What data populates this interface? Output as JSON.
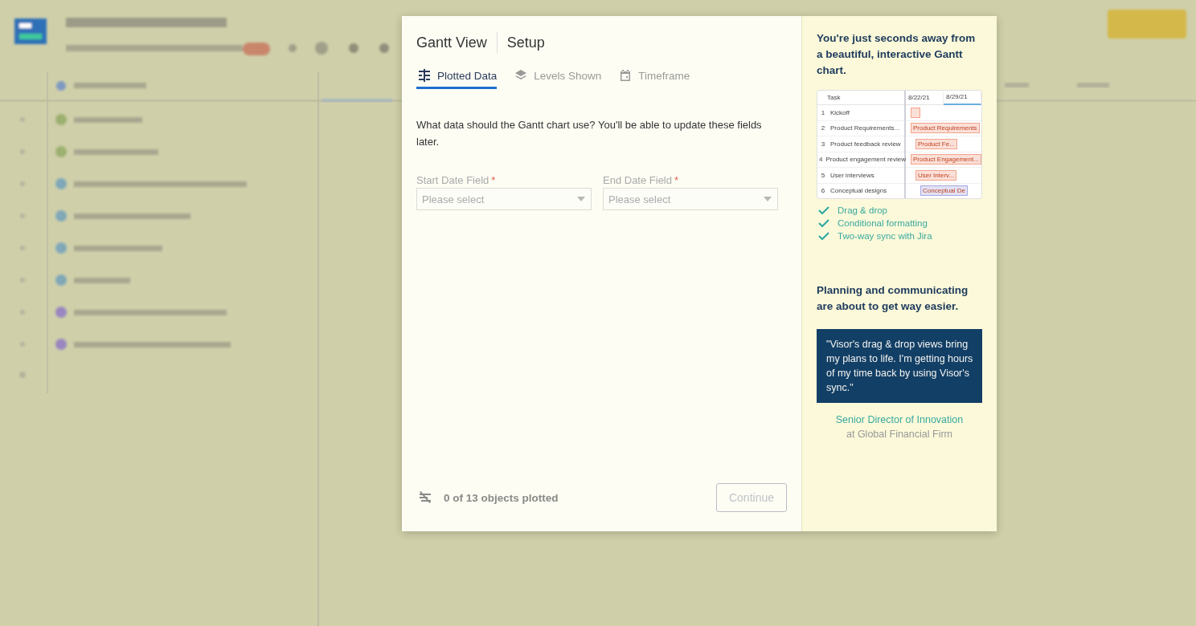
{
  "modal": {
    "title": "Gantt View",
    "subtitle": "Setup",
    "tabs": [
      {
        "label": "Plotted Data",
        "selected": true
      },
      {
        "label": "Levels Shown",
        "selected": false
      },
      {
        "label": "Timeframe",
        "selected": false
      }
    ],
    "intro": "What data should the Gantt chart use? You'll be able to update these fields later.",
    "fields": [
      {
        "label": "Start Date Field",
        "required_mark": "*",
        "placeholder": "Please select"
      },
      {
        "label": "End Date Field",
        "required_mark": "*",
        "placeholder": "Please select"
      }
    ],
    "status": "0 of 13 objects plotted",
    "continue": {
      "label": "Continue",
      "disabled": true
    }
  },
  "promo": {
    "headline": "You're just seconds away from a beautiful, interactive Gantt chart.",
    "preview": {
      "task_header": "Task",
      "dates": [
        "8/22/21",
        "8/29/21"
      ],
      "rows": [
        {
          "num": "1",
          "task": "Kickoff",
          "bar": "",
          "color": "#f4a38a"
        },
        {
          "num": "2",
          "task": "Product Requirements...",
          "bar": "Product Requirements",
          "color": "#f4a38a"
        },
        {
          "num": "3",
          "task": "Product feedback review",
          "bar": "Product Fe...",
          "color": "#f4a38a"
        },
        {
          "num": "4",
          "task": "Product engagement review",
          "bar": "Product Engagement...",
          "color": "#f4a38a"
        },
        {
          "num": "5",
          "task": "User interviews",
          "bar": "User Interv...",
          "color": "#f4a38a"
        },
        {
          "num": "6",
          "task": "Conceptual designs",
          "bar": "Conceptual De",
          "color": "#a9a8e0"
        }
      ]
    },
    "features": [
      "Drag & drop",
      "Conditional formatting",
      "Two-way sync with Jira"
    ],
    "tagline": "Planning and communicating are about to get way easier.",
    "quote": "\"Visor's drag & drop views bring my plans to life. I'm getting hours of my time back by using Visor's sync.\"",
    "author": "Senior Director of Innovation",
    "company": "at Global Financial Firm"
  }
}
